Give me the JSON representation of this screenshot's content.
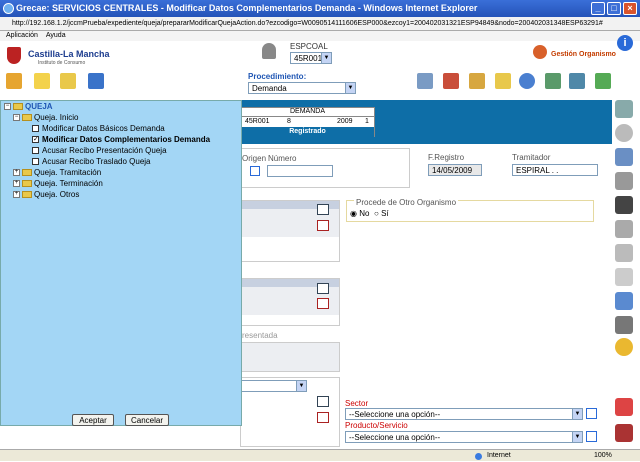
{
  "window": {
    "title": "Grecae: SERVICIOS CENTRALES - Modificar Datos Complementarios Demanda - Windows Internet Explorer",
    "url": "http://192.168.1.2/jccmPrueba/expediente/queja/prepararModificarQuejaAction.do?ezcodigo=W0090514111606ESP000&ezcoy1=200402031321ESP94849&nodo=200402031348ESP63291#"
  },
  "menu": {
    "aplicacion": "Aplicación",
    "ayuda": "Ayuda"
  },
  "header": {
    "logo": "Castilla-La Mancha",
    "logo_sub": "Instituto de Consumo",
    "espcoal": "ESPCOAL",
    "espcoal_value": "45R001",
    "procedimiento_label": "Procedimiento:",
    "procedimiento_value": "Demanda",
    "gestion": "Gestión Organismo",
    "help": "i"
  },
  "demanda": {
    "title": "DEMANDA",
    "code": "45R001",
    "num": "8",
    "year": "2009",
    "seq": "1",
    "status": "Registrado"
  },
  "form": {
    "origen_label": "Origen",
    "numero_label": "Número",
    "numero_value": "",
    "fregistro_label": "F.Registro",
    "fregistro_value": "14/05/2009",
    "tramitador_label": "Tramitador",
    "tramitador_value": "ESPIRAL . .",
    "procede_title": "Procede de Otro Organismo",
    "radio_no": "No",
    "radio_si": "Sí",
    "presentada_label": "resentada",
    "sector_label": "Sector",
    "sector_value": "--Seleccione una opción--",
    "producto_label": "Producto/Servicio",
    "producto_value": "--Seleccione una opción--"
  },
  "tree": {
    "root": "QUEJA",
    "inicio": "Queja. Inicio",
    "items": [
      {
        "label": "Modificar Datos Básicos Demanda",
        "checked": false
      },
      {
        "label": "Modificar Datos Complementarios Demanda",
        "checked": true
      },
      {
        "label": "Acusar Recibo Presentación Queja",
        "checked": false
      },
      {
        "label": "Acusar Recibo Traslado Queja",
        "checked": false
      }
    ],
    "tramitacion": "Queja. Tramitación",
    "terminacion": "Queja. Terminación",
    "otros": "Queja. Otros",
    "accept": "Aceptar",
    "cancel": "Cancelar"
  },
  "status": {
    "zone": "Internet",
    "zoom": "100%"
  }
}
